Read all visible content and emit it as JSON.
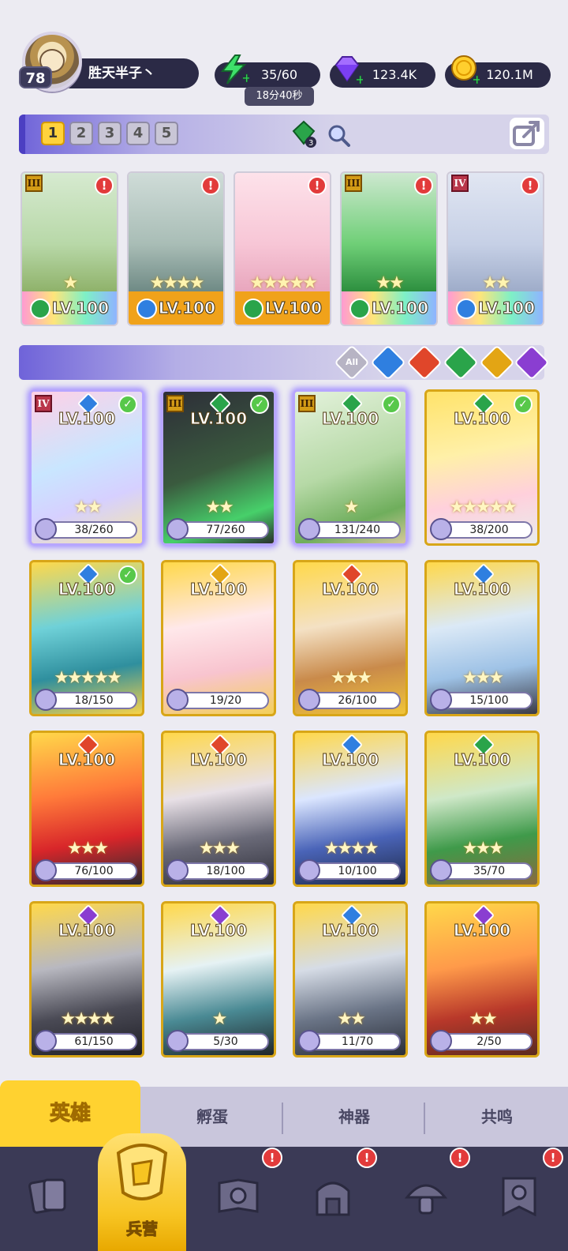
{
  "player": {
    "name": "胜天半子丶",
    "level": "78"
  },
  "resources": {
    "energy": "35/60",
    "energy_timer": "18分40秒",
    "gems": "123.4K",
    "gold": "120.1M"
  },
  "team_tabs": [
    "1",
    "2",
    "3",
    "4",
    "5"
  ],
  "team_gem_count": "3",
  "team_cards": [
    {
      "level": "LV.100",
      "stars": "★",
      "rank": "III",
      "element": "nature",
      "alert": "!"
    },
    {
      "level": "LV.100",
      "stars": "★★★★",
      "rank": "",
      "element": "water",
      "alert": "!"
    },
    {
      "level": "LV.100",
      "stars": "★★★★★",
      "rank": "",
      "element": "nature",
      "alert": "!"
    },
    {
      "level": "LV.100",
      "stars": "★★",
      "rank": "III",
      "element": "nature",
      "alert": "!"
    },
    {
      "level": "LV.100",
      "stars": "★★",
      "rank": "IV",
      "element": "water",
      "alert": "!"
    }
  ],
  "filters": [
    "All",
    "water",
    "fire",
    "nature",
    "light",
    "dark"
  ],
  "filter_all_label": "All",
  "heroes": [
    {
      "level": "LV.100",
      "stars": "★★",
      "fragments": "38/260",
      "rank": "IV",
      "element": "water",
      "check": "✓"
    },
    {
      "level": "LV.100",
      "stars": "★★",
      "fragments": "77/260",
      "rank": "III",
      "element": "nature",
      "check": "✓"
    },
    {
      "level": "LV.100",
      "stars": "★",
      "fragments": "131/240",
      "rank": "III",
      "element": "nature",
      "check": "✓"
    },
    {
      "level": "LV.100",
      "stars": "★★★★★",
      "fragments": "38/200",
      "rank": "",
      "element": "nature",
      "check": "✓"
    },
    {
      "level": "LV.100",
      "stars": "★★★★★",
      "fragments": "18/150",
      "rank": "",
      "element": "water",
      "check": "✓"
    },
    {
      "level": "LV.100",
      "stars": "",
      "fragments": "19/20",
      "rank": "",
      "element": "light",
      "check": ""
    },
    {
      "level": "LV.100",
      "stars": "★★★",
      "fragments": "26/100",
      "rank": "",
      "element": "fire",
      "check": ""
    },
    {
      "level": "LV.100",
      "stars": "★★★",
      "fragments": "15/100",
      "rank": "",
      "element": "water",
      "check": ""
    },
    {
      "level": "LV.100",
      "stars": "★★★",
      "fragments": "76/100",
      "rank": "",
      "element": "fire",
      "check": ""
    },
    {
      "level": "LV.100",
      "stars": "★★★",
      "fragments": "18/100",
      "rank": "",
      "element": "fire",
      "check": ""
    },
    {
      "level": "LV.100",
      "stars": "★★★★",
      "fragments": "10/100",
      "rank": "",
      "element": "water",
      "check": ""
    },
    {
      "level": "LV.100",
      "stars": "★★★",
      "fragments": "35/70",
      "rank": "",
      "element": "nature",
      "check": ""
    },
    {
      "level": "LV.100",
      "stars": "★★★★",
      "fragments": "61/150",
      "rank": "",
      "element": "dark",
      "check": ""
    },
    {
      "level": "LV.100",
      "stars": "★",
      "fragments": "5/30",
      "rank": "",
      "element": "dark",
      "check": ""
    },
    {
      "level": "LV.100",
      "stars": "★★",
      "fragments": "11/70",
      "rank": "",
      "element": "water",
      "check": ""
    },
    {
      "level": "LV.100",
      "stars": "★★",
      "fragments": "2/50",
      "rank": "",
      "element": "dark",
      "check": ""
    }
  ],
  "sub_tabs": {
    "heroes": "英雄",
    "hatch": "孵蛋",
    "artifacts": "神器",
    "resonance": "共鸣"
  },
  "nav": {
    "active_label": "兵营",
    "alert_mark": "!"
  },
  "colors": {
    "water": "#2f7fe0",
    "fire": "#e0462a",
    "nature": "#2aa44a",
    "light": "#e3a514",
    "dark": "#8a3ed1",
    "accent_yellow": "#ffd230",
    "header_pill": "#2b2a46"
  }
}
